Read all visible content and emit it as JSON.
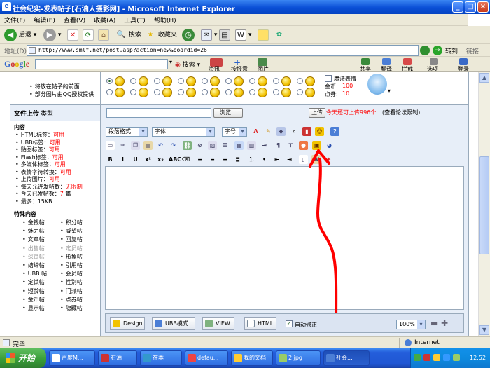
{
  "window": {
    "title": "社会纪实-发表帖子[石油人摄影网] - Microsoft Internet Explorer"
  },
  "menu": [
    "文件(F)",
    "编辑(E)",
    "查看(V)",
    "收藏(A)",
    "工具(T)",
    "帮助(H)"
  ],
  "toolbar": {
    "back": "后退",
    "search": "搜索",
    "favorites": "收藏夹"
  },
  "address": {
    "label": "地址(D)",
    "url": "http://www.smlf.net/post.asp?action=new&boardid=26",
    "go": "转到",
    "links": "链接"
  },
  "google": {
    "logo": "Google",
    "search": "搜索",
    "items": [
      "资讯",
      "按报意",
      "图片"
    ],
    "right": [
      "共享",
      "翻译",
      "拦截",
      "选项"
    ],
    "login": "登录"
  },
  "emoticon": {
    "note1": "将放在帖子的前面",
    "note2": "部分图片由QQ授权提供",
    "magic_label": "魔法表情",
    "coins_label": "金币:",
    "coins_value": "100",
    "points_label": "点券:",
    "points_value": "10"
  },
  "upload": {
    "label": "文件上传",
    "type": "类型",
    "browse": "浏览...",
    "button": "上传",
    "info_red": "今天还可上传996个",
    "info_rest": "(查看论坛限制)"
  },
  "content_info": {
    "heading": "内容",
    "items": [
      {
        "label": "HTML标签：",
        "value": "可用"
      },
      {
        "label": "UBB标签：",
        "value": "可用"
      },
      {
        "label": "贴图标签：",
        "value": "可用"
      },
      {
        "label": "Flash标签：",
        "value": "可用"
      },
      {
        "label": "多媒体标签：",
        "value": "可用"
      },
      {
        "label": "表情字符转换：",
        "value": "可用"
      },
      {
        "label": "上传图片：",
        "value": "可用"
      },
      {
        "label": "每天允许发帖数：",
        "value": "无限制"
      },
      {
        "label": "今天已发帖数：",
        "value": "7",
        "suffix": " 篇"
      },
      {
        "label": "最多：",
        "value": "15KB",
        "plain": true
      }
    ]
  },
  "special": {
    "heading": "特殊内容",
    "left": [
      "金钱帖",
      "魅力帖",
      "文章帖",
      "出售帖",
      "深锁帖",
      "结缔帖",
      "UBB 帖",
      "定锁帖",
      "短龄帖",
      "金币帖",
      "显示帖"
    ],
    "right": [
      "积分帖",
      "威望帖",
      "回复帖",
      "定员帖",
      "形象帖",
      "引用帖",
      "会员帖",
      "性别帖",
      "门派帖",
      "点券帖",
      "隐藏帖"
    ],
    "grey": [
      "出售帖",
      "深锁帖",
      "定员帖"
    ]
  },
  "editor": {
    "paragraph": "段落格式",
    "font": "字体",
    "size": "字号",
    "tabs": [
      "Design",
      "UBB模式",
      "VIEW",
      "HTML"
    ],
    "autofix": "自动修正",
    "zoom": "100%"
  },
  "status": {
    "left": "完毕",
    "zone": "Internet"
  },
  "taskbar": {
    "start": "开始",
    "tasks": [
      "百度M...",
      "石油",
      "在本",
      "defau...",
      "我的文档",
      "2 jpg",
      "社会..."
    ],
    "clock": "12:52"
  },
  "colors": {
    "xp_blue": "#0a4fd6",
    "band": "#e7eef8",
    "red": "#ff0000",
    "annotation": "#ff0000"
  }
}
